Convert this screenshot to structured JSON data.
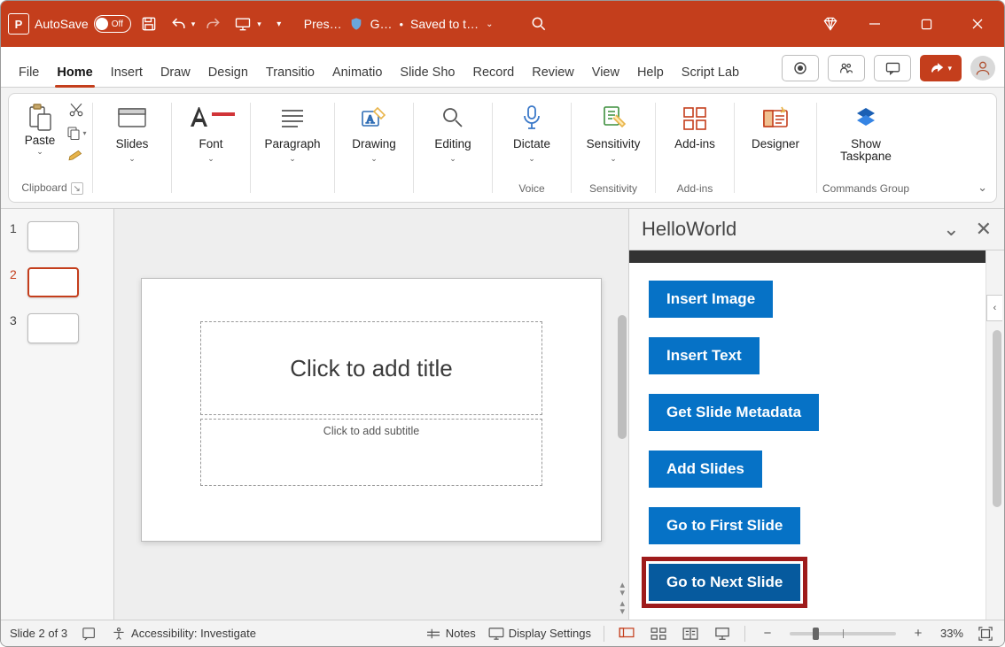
{
  "titlebar": {
    "autosave_label": "AutoSave",
    "autosave_state": "Off",
    "doc_short": "Pres…",
    "privacy_short": "G…",
    "saved_status": "Saved to t…"
  },
  "tabs": {
    "file": "File",
    "home": "Home",
    "insert": "Insert",
    "draw": "Draw",
    "design": "Design",
    "transitions": "Transitio",
    "animations": "Animatio",
    "slideshow": "Slide Sho",
    "record": "Record",
    "review": "Review",
    "view": "View",
    "help": "Help",
    "scriptlab": "Script Lab"
  },
  "ribbon": {
    "clipboard": {
      "paste": "Paste",
      "group": "Clipboard"
    },
    "slides": {
      "label": "Slides"
    },
    "font": {
      "label": "Font"
    },
    "paragraph": {
      "label": "Paragraph"
    },
    "drawing": {
      "label": "Drawing"
    },
    "editing": {
      "label": "Editing"
    },
    "dictate": {
      "label": "Dictate",
      "group": "Voice"
    },
    "sensitivity": {
      "label": "Sensitivity",
      "group": "Sensitivity"
    },
    "addins": {
      "label": "Add-ins",
      "group": "Add-ins"
    },
    "designer": {
      "label": "Designer"
    },
    "showtp": {
      "label1": "Show",
      "label2": "Taskpane",
      "group": "Commands Group"
    }
  },
  "thumbs": [
    {
      "n": "1",
      "selected": false
    },
    {
      "n": "2",
      "selected": true
    },
    {
      "n": "3",
      "selected": false
    }
  ],
  "slide": {
    "title_placeholder": "Click to add title",
    "subtitle_placeholder": "Click to add subtitle"
  },
  "taskpane": {
    "title": "HelloWorld",
    "buttons": {
      "insert_image": "Insert Image",
      "insert_text": "Insert Text",
      "get_meta": "Get Slide Metadata",
      "add_slides": "Add Slides",
      "go_first": "Go to First Slide",
      "go_next": "Go to Next Slide"
    }
  },
  "status": {
    "slide_info": "Slide 2 of 3",
    "accessibility": "Accessibility: Investigate",
    "notes": "Notes",
    "display_settings": "Display Settings",
    "zoom_pct": "33%"
  }
}
